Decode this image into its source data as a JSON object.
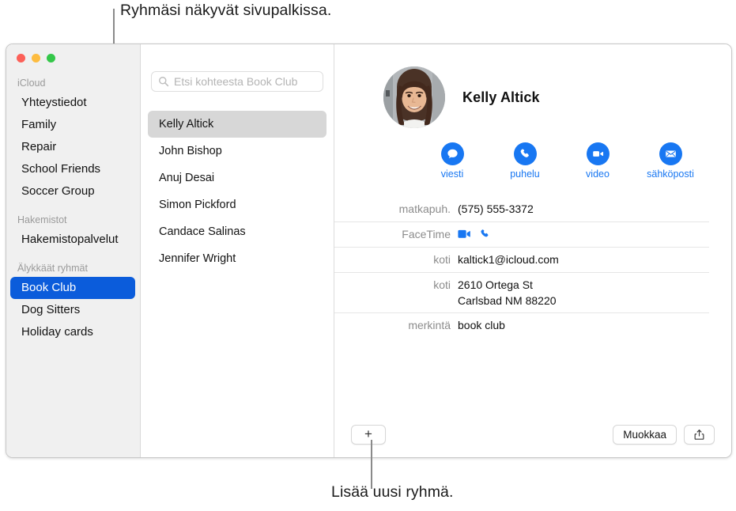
{
  "annotations": {
    "top": "Ryhmäsi näkyvät sivupalkissa.",
    "bottom": "Lisää uusi ryhmä."
  },
  "window": {
    "traffic_lights": {
      "close": "close-button",
      "minimize": "minimize-button",
      "maximize": "maximize-button"
    }
  },
  "sidebar": {
    "sections": [
      {
        "header": "iCloud",
        "items": [
          {
            "label": "Yhteystiedot",
            "selected": false
          },
          {
            "label": "Family",
            "selected": false
          },
          {
            "label": "Repair",
            "selected": false
          },
          {
            "label": "School Friends",
            "selected": false
          },
          {
            "label": "Soccer Group",
            "selected": false
          }
        ]
      },
      {
        "header": "Hakemistot",
        "items": [
          {
            "label": "Hakemistopalvelut",
            "selected": false
          }
        ]
      },
      {
        "header": "Älykkäät ryhmät",
        "items": [
          {
            "label": "Book Club",
            "selected": true
          },
          {
            "label": "Dog Sitters",
            "selected": false
          },
          {
            "label": "Holiday cards",
            "selected": false
          }
        ]
      }
    ],
    "selected_color": "#0b5cdb"
  },
  "search": {
    "placeholder": "Etsi kohteesta Book Club",
    "value": "",
    "icon": "search-icon"
  },
  "contact_list": {
    "items": [
      {
        "name": "Kelly Altick",
        "selected": true
      },
      {
        "name": "John Bishop",
        "selected": false
      },
      {
        "name": "Anuj Desai",
        "selected": false
      },
      {
        "name": "Simon Pickford",
        "selected": false
      },
      {
        "name": "Candace Salinas",
        "selected": false
      },
      {
        "name": "Jennifer Wright",
        "selected": false
      }
    ]
  },
  "detail": {
    "name": "Kelly Altick",
    "avatar": "contact-photo",
    "actions": [
      {
        "label": "viesti",
        "icon": "message-icon"
      },
      {
        "label": "puhelu",
        "icon": "phone-icon"
      },
      {
        "label": "video",
        "icon": "video-icon"
      },
      {
        "label": "sähköposti",
        "icon": "mail-icon"
      }
    ],
    "accent_color": "#1877f2",
    "fields": [
      {
        "label": "matkapuh.",
        "type": "text",
        "value": "(575) 555-3372"
      },
      {
        "label": "FaceTime",
        "type": "icons",
        "icons": [
          "facetime-video-icon",
          "facetime-audio-icon"
        ]
      },
      {
        "label": "koti",
        "type": "text",
        "value": "kaltick1@icloud.com"
      },
      {
        "label": "koti",
        "type": "multiline",
        "lines": [
          "2610 Ortega St",
          "Carlsbad NM 88220"
        ]
      },
      {
        "label": "merkintä",
        "type": "text",
        "value": "book club"
      }
    ]
  },
  "bottom_bar": {
    "add_label": "+",
    "edit_label": "Muokkaa",
    "share_icon": "share-icon"
  }
}
